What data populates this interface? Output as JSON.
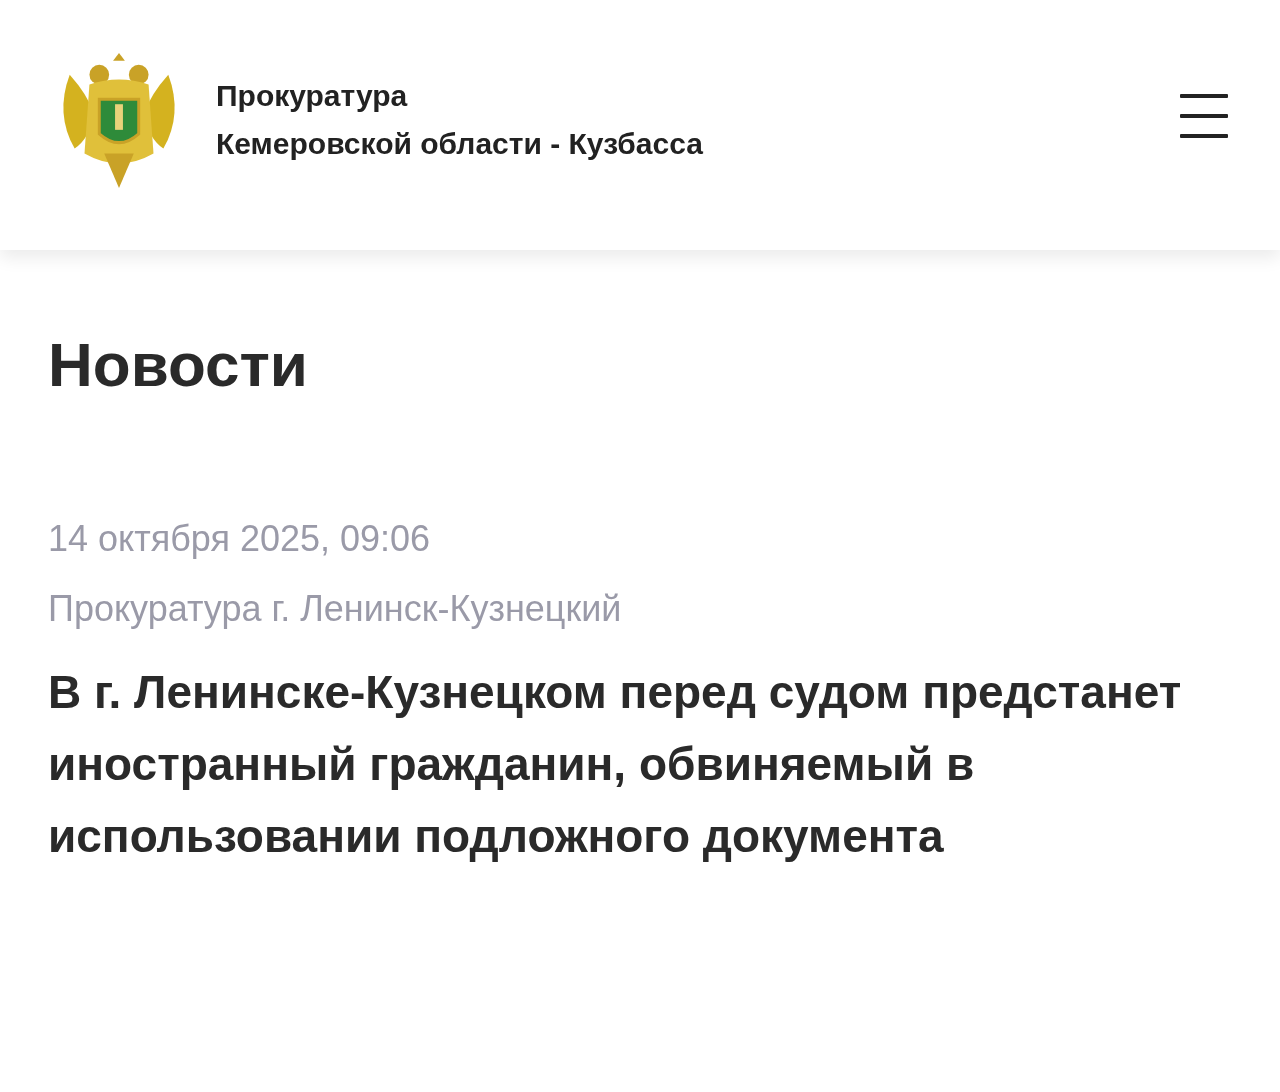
{
  "header": {
    "title_lines": [
      "Прокуратура",
      "Кемеровской области - Кузбасса"
    ]
  },
  "section": {
    "heading": "Новости"
  },
  "article": {
    "date": "14 октября 2025, 09:06",
    "source": "Прокуратура г. Ленинск-Кузнецкий",
    "title": "В г. Ленинске-Кузнецком перед судом предстанет иностранный гражданин, обвиняемый в использовании подложного документа"
  }
}
